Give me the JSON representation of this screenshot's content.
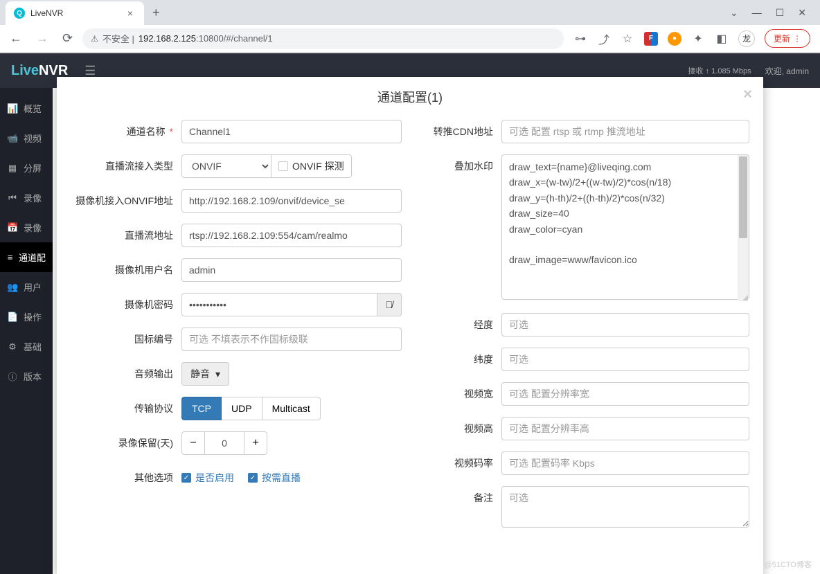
{
  "browser": {
    "tab_title": "LiveNVR",
    "insecure_label": "不安全",
    "url_host": "192.168.2.125",
    "url_port_path": ":10800/#/channel/1",
    "update_label": "更新",
    "profile_initial": "龙"
  },
  "app": {
    "logo_live": "Live",
    "logo_nvr": "NVR",
    "stat_rx_label": "接收",
    "stat_rx_value": "1.085 Mbps",
    "welcome": "欢迎, admin"
  },
  "sidebar": {
    "items": [
      {
        "icon": "📊",
        "label": "概览"
      },
      {
        "icon": "📹",
        "label": "视频"
      },
      {
        "icon": "▦",
        "label": "分屏"
      },
      {
        "icon": "⏮",
        "label": "录像"
      },
      {
        "icon": "📅",
        "label": "录像"
      },
      {
        "icon": "≡",
        "label": "通道配"
      },
      {
        "icon": "👥",
        "label": "用户"
      },
      {
        "icon": "📄",
        "label": "操作"
      },
      {
        "icon": "⚙",
        "label": "基础"
      },
      {
        "icon": "ⓘ",
        "label": "版本"
      }
    ]
  },
  "modal": {
    "title": "通道配置(1)",
    "left": {
      "channel_name_label": "通道名称",
      "channel_name_value": "Channel1",
      "stream_type_label": "直播流接入类型",
      "stream_type_value": "ONVIF",
      "onvif_probe_label": "ONVIF 探测",
      "onvif_url_label": "摄像机接入ONVIF地址",
      "onvif_url_value": "http://192.168.2.109/onvif/device_se",
      "stream_url_label": "直播流地址",
      "stream_url_value": "rtsp://192.168.2.109:554/cam/realmo",
      "username_label": "摄像机用户名",
      "username_value": "admin",
      "password_label": "摄像机密码",
      "password_value": "•••••••••••",
      "gb_id_label": "国标编号",
      "gb_id_placeholder": "可选 不填表示不作国标级联",
      "audio_out_label": "音频输出",
      "audio_out_value": "静音",
      "protocol_label": "传输协议",
      "protocol_options": [
        "TCP",
        "UDP",
        "Multicast"
      ],
      "protocol_active": "TCP",
      "record_keep_label": "录像保留(天)",
      "record_keep_value": "0",
      "other_options_label": "其他选项",
      "enable_label": "是否启用",
      "ondemand_label": "按需直播"
    },
    "right": {
      "cdn_label": "转推CDN地址",
      "cdn_placeholder": "可选 配置 rtsp 或 rtmp 推流地址",
      "watermark_label": "叠加水印",
      "watermark_value": "draw_text={name}@liveqing.com\ndraw_x=(w-tw)/2+((w-tw)/2)*cos(n/18)\ndraw_y=(h-th)/2+((h-th)/2)*cos(n/32)\ndraw_size=40\ndraw_color=cyan\n\ndraw_image=www/favicon.ico",
      "lng_label": "经度",
      "lng_placeholder": "可选",
      "lat_label": "纬度",
      "lat_placeholder": "可选",
      "video_w_label": "视频宽",
      "video_w_placeholder": "可选 配置分辨率宽",
      "video_h_label": "视频高",
      "video_h_placeholder": "可选 配置分辨率高",
      "bitrate_label": "视频码率",
      "bitrate_placeholder": "可选 配置码率 Kbps",
      "remark_label": "备注",
      "remark_placeholder": "可选"
    }
  },
  "page_watermark": "@51CTO博客"
}
